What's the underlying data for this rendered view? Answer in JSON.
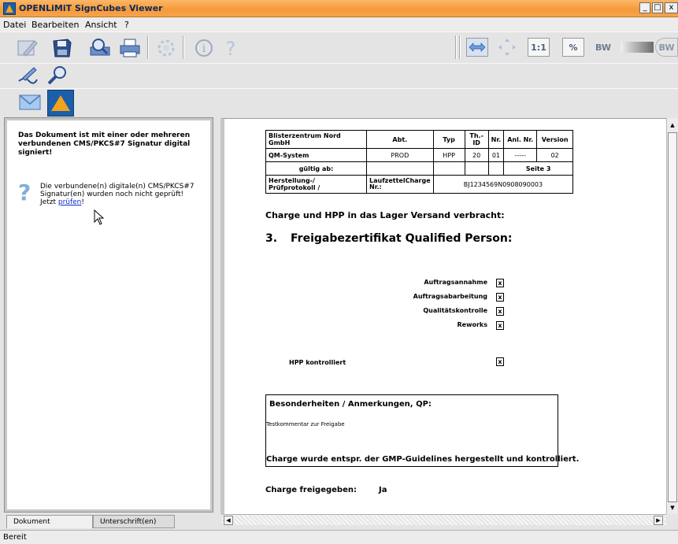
{
  "window": {
    "title": "OPENLiMiT SignCubes Viewer",
    "minimize": "_",
    "maximize": "□",
    "close": "x"
  },
  "menu": [
    "Datei",
    "Bearbeiten",
    "Ansicht",
    "?"
  ],
  "toolbar": {
    "zoom_actual": "1:1",
    "zoom_percent": "%",
    "bw_label": "BW"
  },
  "signature_panel": {
    "status": "Das Dokument ist mit einer oder mehreren verbundenen CMS/PKCS#7 Signatur digital signiert!",
    "verify_message": "Die verbundene(n) digitale(n) CMS/PKCS#7 Signatur(en) wurden noch nicht geprüft!",
    "verify_prefix": "Jetzt",
    "verify_link": "prüfen",
    "verify_suffix": "!"
  },
  "tabs": [
    "Dokument",
    "Unterschrift(en)"
  ],
  "document": {
    "header": {
      "company": "Blisterzentrum Nord GmbH",
      "col_abt": "Abt.",
      "col_typ": "Typ",
      "col_thid": "Th.-ID",
      "col_nr": "Nr.",
      "col_anl": "Anl. Nr.",
      "col_version": "Version",
      "system": "QM-System",
      "abt": "PROD",
      "typ": "HPP",
      "thid": "20",
      "nr": "01",
      "anl": "-----",
      "version": "02",
      "valid_from": "gültig ab:",
      "page": "Seite 3",
      "protocol": "Herstellung-/ Prüfprotokoll /",
      "laufzettel": "LaufzettelCharge Nr.:",
      "charge_no": "BJ1234569N0908090003"
    },
    "intro": "Charge und HPP in das Lager Versand verbracht:",
    "section_number": "3.",
    "section_title": "Freigabezertifikat Qualified Person:",
    "checklist": [
      {
        "label": "Auftragsannahme",
        "mark": "x"
      },
      {
        "label": "Auftragsabarbeitung",
        "mark": "x"
      },
      {
        "label": "Qualitätskontrolle",
        "mark": "x"
      },
      {
        "label": "Reworks",
        "mark": "x"
      }
    ],
    "hpp_label": "HPP kontrolliert",
    "hpp_mark": "x",
    "notes_title": "Besonderheiten / Anmerkungen, QP:",
    "notes_text": "Testkommentar zur Freigabe",
    "gmp_statement": "Charge wurde entspr. der GMP-Guidelines hergestellt und kontrolliert.",
    "release_label": "Charge freigegeben:",
    "release_value": "Ja"
  },
  "status_bar": "Bereit",
  "colors": {
    "titlebar": "#f79a3a",
    "link": "#0a2dc8",
    "icon_blue": "#4a78b8"
  }
}
